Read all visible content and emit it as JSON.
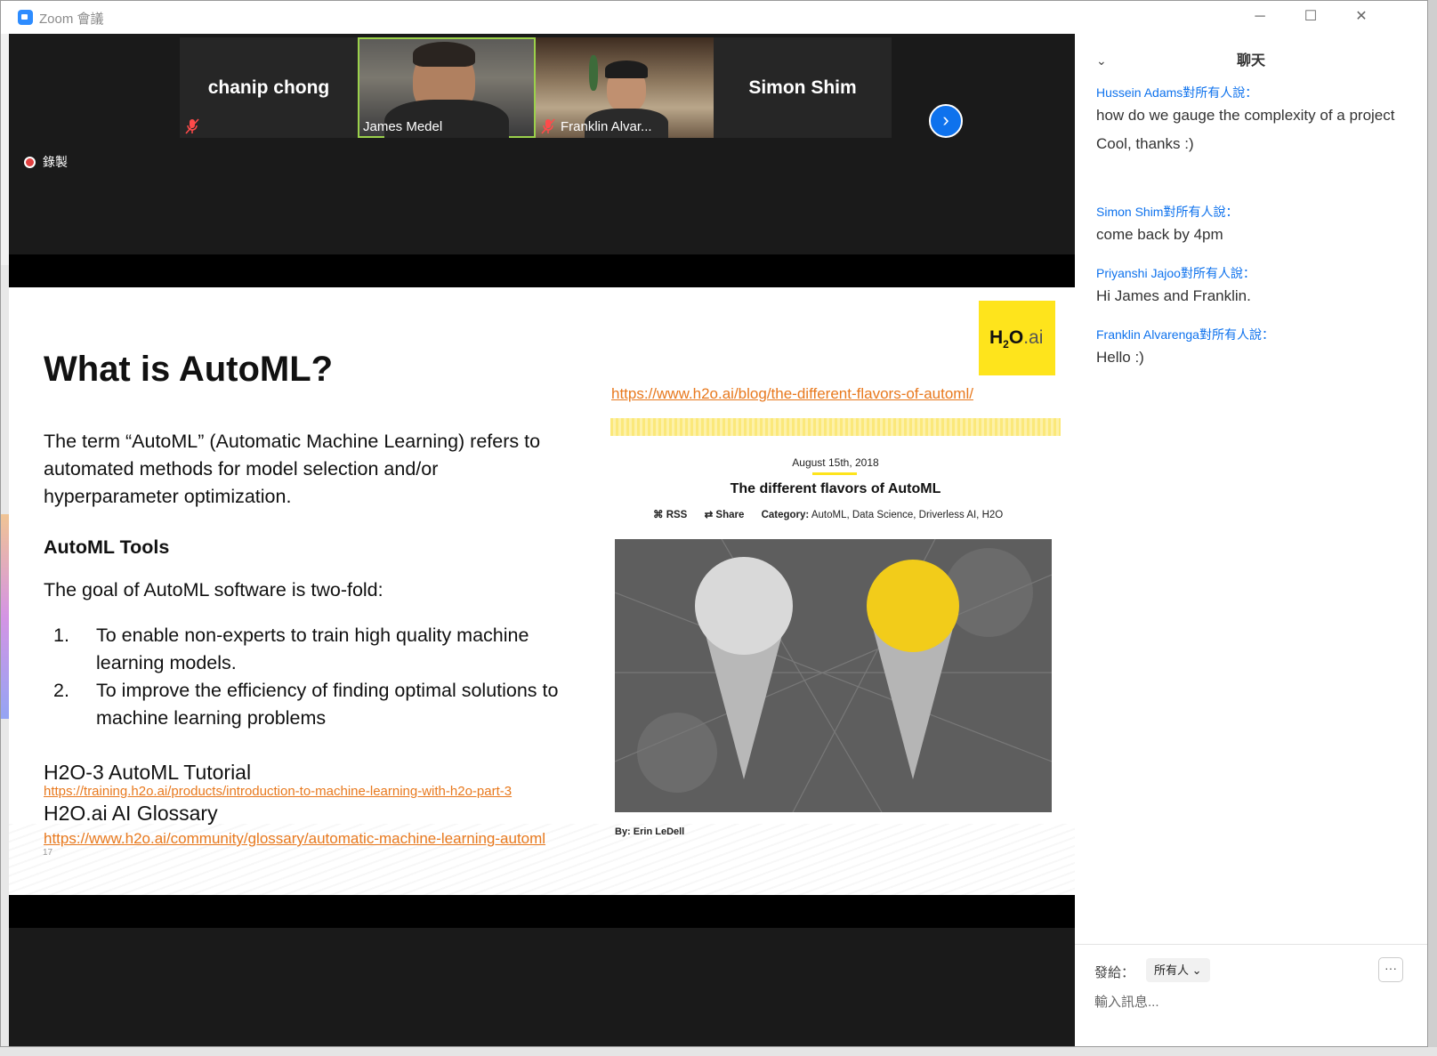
{
  "window": {
    "title": "Zoom 會議",
    "minimize": "─",
    "maximize": "☐",
    "close": "✕"
  },
  "participants": [
    {
      "name": "chanip chong",
      "mode": "name-only",
      "muted": true
    },
    {
      "name": "James Medel",
      "mode": "video",
      "muted": false,
      "active_speaker": true
    },
    {
      "name": "Franklin Alvar...",
      "mode": "video",
      "muted": true
    },
    {
      "name": "Simon Shim",
      "mode": "name-only",
      "muted": false
    }
  ],
  "controls": {
    "next_page": "›",
    "recording_label": "錄製"
  },
  "slide": {
    "title": "What is AutoML?",
    "intro": "The term “AutoML” (Automatic Machine Learning) refers to automated methods for model selection and/or hyperparameter optimization.",
    "tools_heading": "AutoML Tools",
    "goal": "The goal of AutoML software is two-fold:",
    "list": [
      {
        "num": "1.",
        "text": "To enable non-experts to train high quality machine learning models."
      },
      {
        "num": "2.",
        "text": "To improve the efficiency of finding optimal solutions to machine learning problems"
      }
    ],
    "res1_title": "H2O-3 AutoML Tutorial",
    "res1_link": "https://training.h2o.ai/products/introduction-to-machine-learning-with-h2o-part-3",
    "res2_title": "H2O.ai AI Glossary",
    "res2_link": "https://www.h2o.ai/community/glossary/automatic-machine-learning-automl",
    "page_number": "17",
    "logo_text": "H",
    "logo_sub": "2",
    "logo_o": "O",
    "logo_ai": ".ai",
    "blog_url": "https://www.h2o.ai/blog/the-different-flavors-of-automl/",
    "blog": {
      "date": "August 15th, 2018",
      "title": "The different flavors of AutoML",
      "rss": "RSS",
      "share": "Share",
      "category_label": "Category:",
      "category_value": "AutoML, Data Science, Driverless AI, H2O",
      "byline": "By: Erin LeDell"
    }
  },
  "chat": {
    "header": "聊天",
    "messages": [
      {
        "sender": "Hussein Adams",
        "to": "對所有人說：",
        "lines": [
          "how do we gauge the complexity of a project",
          "Cool, thanks :)"
        ]
      },
      {
        "sender": "Simon Shim",
        "to": "對所有人說：",
        "lines": [
          "come back by 4pm"
        ]
      },
      {
        "sender": "Priyanshi Jajoo",
        "to": "對所有人說：",
        "lines": [
          "Hi James and Franklin."
        ]
      },
      {
        "sender": "Franklin Alvarenga",
        "to": "對所有人說：",
        "lines": [
          "Hello :)"
        ]
      }
    ],
    "send_to_label": "發給：",
    "send_to_value": "所有人",
    "more": "···",
    "input_placeholder": "輸入訊息..."
  },
  "colors": {
    "accent": "#0e72ed",
    "link_orange": "#e8791e",
    "h2o_yellow": "#fee41c",
    "active_border": "#9bd14b"
  }
}
